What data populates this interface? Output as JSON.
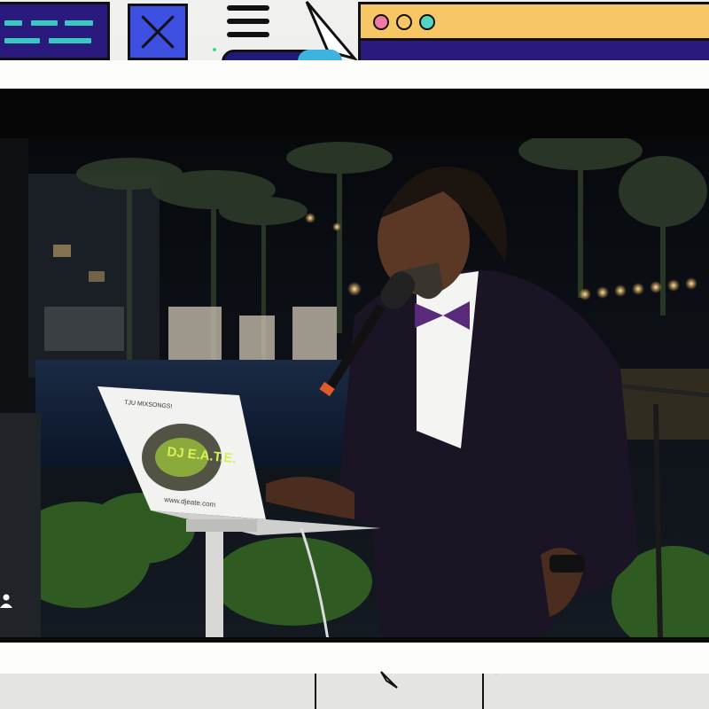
{
  "scene": {
    "background": "paper-texture",
    "frame": "white-card",
    "colors": {
      "navy": "#2b1a7d",
      "teal": "#36c9c0",
      "blue": "#3c4fe0",
      "yellow": "#f7c665",
      "pink": "#f07aa2",
      "mint": "#52d6c1"
    }
  },
  "photo": {
    "laptop_lid_text": "DJ E.A.T.E.",
    "laptop_top_text": "TJU MIXSONGS!",
    "laptop_url": "www.djeate.com"
  },
  "icons": {
    "menu": "hamburger-icon",
    "close": "close-icon",
    "user": "user-icon"
  }
}
